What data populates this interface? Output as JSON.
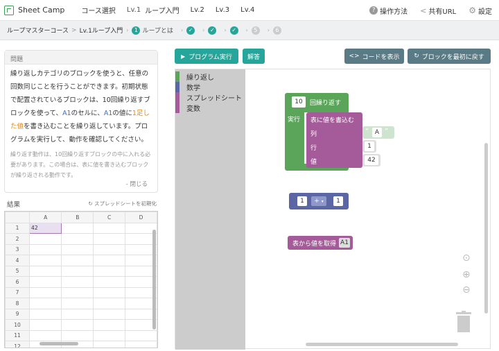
{
  "app": {
    "name": "Sheet Camp"
  },
  "nav": {
    "course_select": "コース選択",
    "lv1": "Lv.1",
    "lv1_name": "ループ入門",
    "lv2": "Lv.2",
    "lv3": "Lv.3",
    "lv4": "Lv.4",
    "howto": "操作方法",
    "share": "共有URL",
    "settings": "設定"
  },
  "breadcrumb": {
    "course": "ループマスターコース",
    "sep": ">",
    "level": "Lv.1ループ入門",
    "steps": [
      {
        "num": "1",
        "label": "ループとは",
        "state": "current"
      },
      {
        "num": "✓",
        "state": "done"
      },
      {
        "num": "✓",
        "state": "done"
      },
      {
        "num": "✓",
        "state": "done"
      },
      {
        "num": "5",
        "state": "todo"
      },
      {
        "num": "6",
        "state": "todo"
      }
    ]
  },
  "problem": {
    "header": "問題",
    "text_p1": "繰り返しカテゴリのブロックを使うと、任意の回数同じことを行うことができます。初期状態で配置されているブロックは、10回繰り返すブロックを使って、",
    "text_a1": "A1",
    "text_p2": "のセルに、",
    "text_a1b": "A1",
    "text_p3": "の値に",
    "text_plus": "1足した値",
    "text_p4": "を書き込むことを繰り返しています。プログラムを実行して、動作を確認してください。",
    "hint": "繰り返す動作は、10回繰り返すブロックの中に入れる必要があります。この場合は、表に値を書き込むブロックが繰り返される動作です。",
    "close": "- 閉じる"
  },
  "result": {
    "title": "結果",
    "reset_sheet": "スプレッドシートを初期化",
    "columns": [
      "A",
      "B",
      "C",
      "D"
    ],
    "rows": [
      "1",
      "2",
      "3",
      "4",
      "5",
      "6",
      "7",
      "8",
      "9",
      "10",
      "11",
      "12"
    ],
    "a1_value": "42"
  },
  "toolbar": {
    "run": "プログラム実行",
    "answer": "解答",
    "show_code": "コードを表示",
    "reset_blocks": "ブロックを最初に戻す"
  },
  "categories": [
    {
      "label": "繰り返し",
      "color": "#5ba55b"
    },
    {
      "label": "数学",
      "color": "#5b67a5"
    },
    {
      "label": "スプレッドシート",
      "color": "#a55b99"
    },
    {
      "label": "変数",
      "color": "#a55b99"
    }
  ],
  "blocks": {
    "repeat_count": "10",
    "repeat_label": "回繰り返す",
    "do_label": "実行",
    "write_label": "表に値を書込む",
    "col_label": "列",
    "row_label": "行",
    "val_label": "値",
    "col_value": "A",
    "row_value": "1",
    "val_value": "42",
    "math_left": "1",
    "math_op": "+",
    "math_right": "1",
    "get_label": "表から値を取得",
    "get_cell": "A1"
  },
  "colors": {
    "loop": "#5ba55b",
    "math": "#5b67a5",
    "sheet": "#a55b99",
    "teal": "#26a69a",
    "slate": "#5a7b85"
  }
}
